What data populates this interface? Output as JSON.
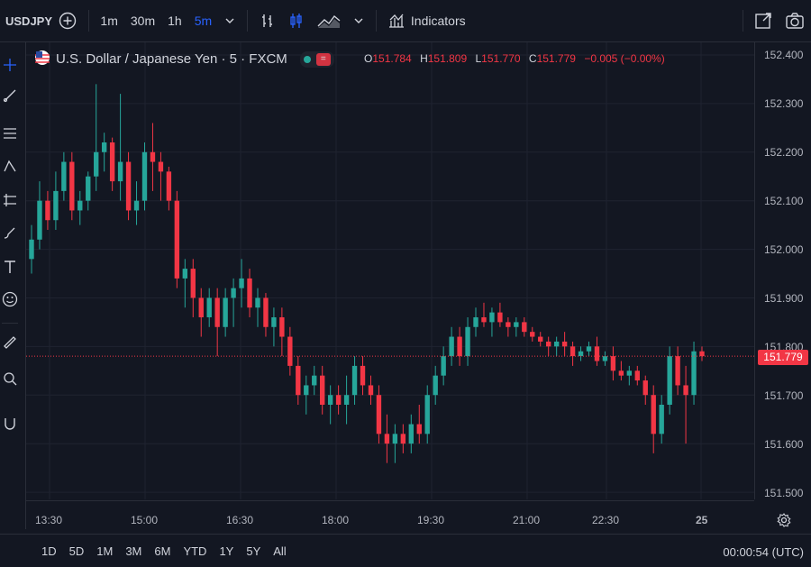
{
  "symbol": "USDJPY",
  "toolbar": {
    "intervals": [
      "1m",
      "30m",
      "1h",
      "5m"
    ],
    "active_interval": "5m",
    "indicators_label": "Indicators"
  },
  "legend": {
    "title": "U.S. Dollar / Japanese Yen · 5 · FXCM",
    "ohlc": [
      {
        "k": "O",
        "v": "151.784"
      },
      {
        "k": "H",
        "v": "151.809"
      },
      {
        "k": "L",
        "v": "151.770"
      },
      {
        "k": "C",
        "v": "151.779"
      }
    ],
    "change": "−0.005 (−0.00%)"
  },
  "price_axis": {
    "ticks": [
      "152.400",
      "152.300",
      "152.200",
      "152.100",
      "152.000",
      "151.900",
      "151.800",
      "151.700",
      "151.600",
      "151.500"
    ],
    "current": "151.779"
  },
  "time_axis": {
    "ticks": [
      "13:30",
      "15:00",
      "16:30",
      "18:00",
      "19:30",
      "21:00",
      "22:30",
      "25"
    ]
  },
  "bottombar": {
    "ranges": [
      "1D",
      "5D",
      "1M",
      "3M",
      "6M",
      "YTD",
      "1Y",
      "5Y",
      "All"
    ],
    "clock": "00:00:54 (UTC)"
  },
  "colors": {
    "up": "#26a69a",
    "down": "#f23645",
    "background": "#131722",
    "accent": "#2962ff"
  },
  "icons": [
    "add-symbol-icon",
    "bars-icon",
    "candles-icon",
    "area-icon",
    "indicators-icon",
    "snapshot-icon",
    "camera-icon",
    "settings-icon",
    "crosshair-icon",
    "trendline-icon",
    "fib-icon",
    "pattern-icon",
    "projection-icon",
    "brush-icon",
    "text-icon",
    "emoji-icon",
    "ruler-icon",
    "zoom-icon",
    "magnet-icon"
  ],
  "chart_data": {
    "type": "candlestick",
    "x": [
      "13:30",
      "15:00",
      "16:30",
      "18:00",
      "19:30",
      "21:00",
      "22:30",
      "25"
    ],
    "ylim": [
      151.48,
      152.42
    ],
    "ohlc": [
      [
        151.98,
        152.05,
        151.95,
        152.02
      ],
      [
        152.02,
        152.14,
        152.0,
        152.1
      ],
      [
        152.1,
        152.12,
        152.04,
        152.06
      ],
      [
        152.06,
        152.16,
        152.04,
        152.12
      ],
      [
        152.12,
        152.2,
        152.1,
        152.18
      ],
      [
        152.18,
        152.2,
        152.06,
        152.08
      ],
      [
        152.08,
        152.12,
        152.05,
        152.1
      ],
      [
        152.1,
        152.16,
        152.08,
        152.15
      ],
      [
        152.15,
        152.34,
        152.12,
        152.2
      ],
      [
        152.2,
        152.24,
        152.16,
        152.22
      ],
      [
        152.22,
        152.23,
        152.12,
        152.14
      ],
      [
        152.14,
        152.32,
        152.1,
        152.18
      ],
      [
        152.18,
        152.2,
        152.06,
        152.08
      ],
      [
        152.08,
        152.14,
        152.05,
        152.1
      ],
      [
        152.1,
        152.22,
        152.08,
        152.2
      ],
      [
        152.2,
        152.26,
        152.12,
        152.18
      ],
      [
        152.18,
        152.2,
        152.1,
        152.16
      ],
      [
        152.16,
        152.17,
        152.08,
        152.1
      ],
      [
        152.1,
        152.12,
        151.92,
        151.94
      ],
      [
        151.94,
        151.98,
        151.88,
        151.96
      ],
      [
        151.96,
        151.98,
        151.86,
        151.9
      ],
      [
        151.9,
        151.92,
        151.82,
        151.86
      ],
      [
        151.86,
        151.92,
        151.84,
        151.9
      ],
      [
        151.9,
        151.92,
        151.78,
        151.84
      ],
      [
        151.84,
        151.92,
        151.82,
        151.9
      ],
      [
        151.9,
        151.94,
        151.84,
        151.92
      ],
      [
        151.92,
        151.98,
        151.88,
        151.94
      ],
      [
        151.94,
        151.96,
        151.86,
        151.88
      ],
      [
        151.88,
        151.92,
        151.84,
        151.9
      ],
      [
        151.9,
        151.91,
        151.82,
        151.84
      ],
      [
        151.84,
        151.88,
        151.8,
        151.86
      ],
      [
        151.86,
        151.88,
        151.78,
        151.82
      ],
      [
        151.82,
        151.84,
        151.74,
        151.76
      ],
      [
        151.76,
        151.78,
        151.68,
        151.7
      ],
      [
        151.7,
        151.74,
        151.66,
        151.72
      ],
      [
        151.72,
        151.76,
        151.7,
        151.74
      ],
      [
        151.74,
        151.76,
        151.66,
        151.68
      ],
      [
        151.68,
        151.72,
        151.64,
        151.7
      ],
      [
        151.7,
        151.72,
        151.66,
        151.68
      ],
      [
        151.68,
        151.74,
        151.64,
        151.7
      ],
      [
        151.7,
        151.78,
        151.68,
        151.76
      ],
      [
        151.76,
        151.78,
        151.7,
        151.72
      ],
      [
        151.72,
        151.74,
        151.68,
        151.7
      ],
      [
        151.7,
        151.72,
        151.6,
        151.62
      ],
      [
        151.62,
        151.66,
        151.56,
        151.6
      ],
      [
        151.6,
        151.64,
        151.56,
        151.62
      ],
      [
        151.62,
        151.64,
        151.58,
        151.6
      ],
      [
        151.6,
        151.66,
        151.58,
        151.64
      ],
      [
        151.64,
        151.68,
        151.6,
        151.62
      ],
      [
        151.62,
        151.72,
        151.6,
        151.7
      ],
      [
        151.7,
        151.76,
        151.68,
        151.74
      ],
      [
        151.74,
        151.8,
        151.72,
        151.78
      ],
      [
        151.78,
        151.84,
        151.76,
        151.82
      ],
      [
        151.82,
        151.84,
        151.76,
        151.78
      ],
      [
        151.78,
        151.86,
        151.76,
        151.84
      ],
      [
        151.84,
        151.88,
        151.82,
        151.86
      ],
      [
        151.86,
        151.89,
        151.84,
        151.85
      ],
      [
        151.85,
        151.88,
        151.82,
        151.87
      ],
      [
        151.87,
        151.89,
        151.84,
        151.85
      ],
      [
        151.85,
        151.86,
        151.82,
        151.84
      ],
      [
        151.84,
        151.86,
        151.82,
        151.85
      ],
      [
        151.85,
        151.86,
        151.82,
        151.83
      ],
      [
        151.83,
        151.84,
        151.81,
        151.82
      ],
      [
        151.82,
        151.83,
        151.8,
        151.81
      ],
      [
        151.81,
        151.82,
        151.78,
        151.8
      ],
      [
        151.8,
        151.82,
        151.78,
        151.81
      ],
      [
        151.81,
        151.83,
        151.78,
        151.8
      ],
      [
        151.8,
        151.81,
        151.76,
        151.78
      ],
      [
        151.78,
        151.8,
        151.77,
        151.79
      ],
      [
        151.79,
        151.81,
        151.78,
        151.8
      ],
      [
        151.8,
        151.82,
        151.76,
        151.77
      ],
      [
        151.77,
        151.79,
        151.76,
        151.78
      ],
      [
        151.78,
        151.8,
        151.73,
        151.75
      ],
      [
        151.75,
        151.77,
        151.73,
        151.74
      ],
      [
        151.74,
        151.76,
        151.72,
        151.75
      ],
      [
        151.75,
        151.76,
        151.72,
        151.73
      ],
      [
        151.73,
        151.74,
        151.68,
        151.7
      ],
      [
        151.7,
        151.72,
        151.58,
        151.62
      ],
      [
        151.62,
        151.7,
        151.6,
        151.68
      ],
      [
        151.68,
        151.8,
        151.66,
        151.78
      ],
      [
        151.78,
        151.8,
        151.7,
        151.72
      ],
      [
        151.72,
        151.76,
        151.6,
        151.7
      ],
      [
        151.7,
        151.81,
        151.68,
        151.79
      ],
      [
        151.79,
        151.8,
        151.77,
        151.78
      ]
    ]
  }
}
